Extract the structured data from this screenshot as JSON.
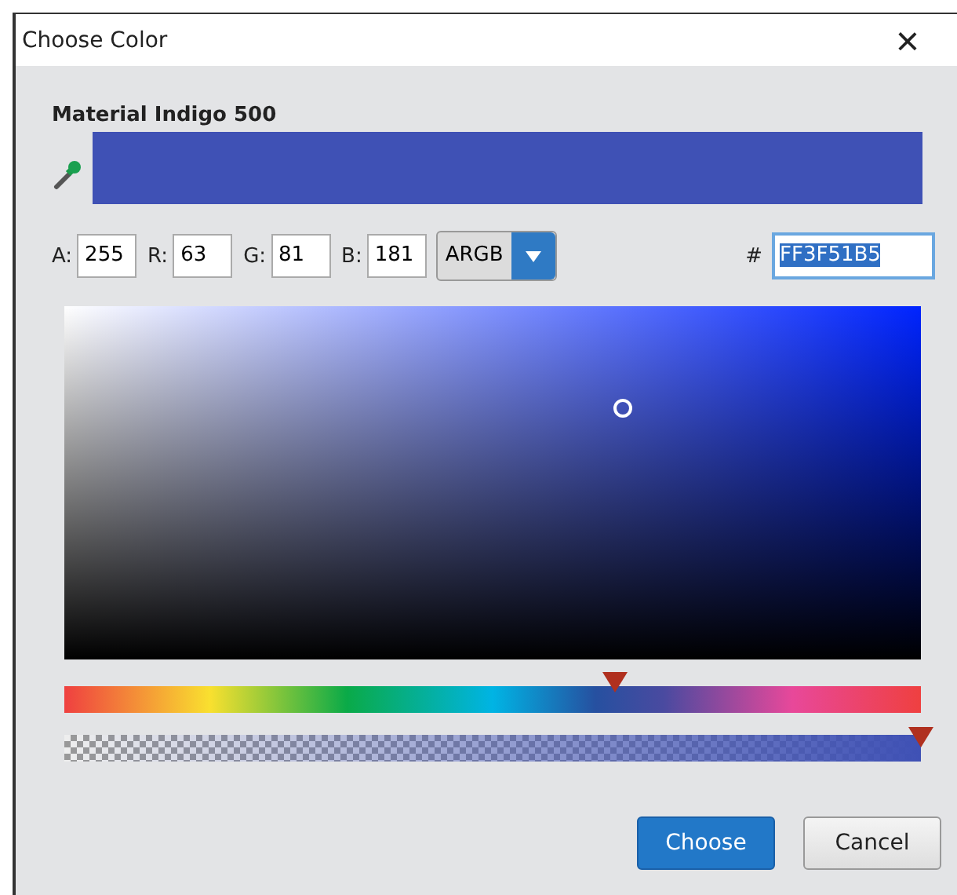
{
  "window": {
    "title": "Choose Color",
    "close": "×"
  },
  "color_name": "Material Indigo 500",
  "channels": [
    {
      "label": "A:",
      "value": "255"
    },
    {
      "label": "R:",
      "value": "63"
    },
    {
      "label": "G:",
      "value": "81"
    },
    {
      "label": "B:",
      "value": "181"
    }
  ],
  "mode_dropdown": {
    "value": "ARGB"
  },
  "hex": {
    "label": "#",
    "value": "FF3F51B5",
    "selected": true
  },
  "hue_slider": {
    "level": 0.643
  },
  "alpha_slider": {
    "level": 1
  },
  "buttons": [
    {
      "label": "Choose",
      "kind": "primary"
    },
    {
      "label": "Cancel",
      "kind": "secondary"
    }
  ]
}
